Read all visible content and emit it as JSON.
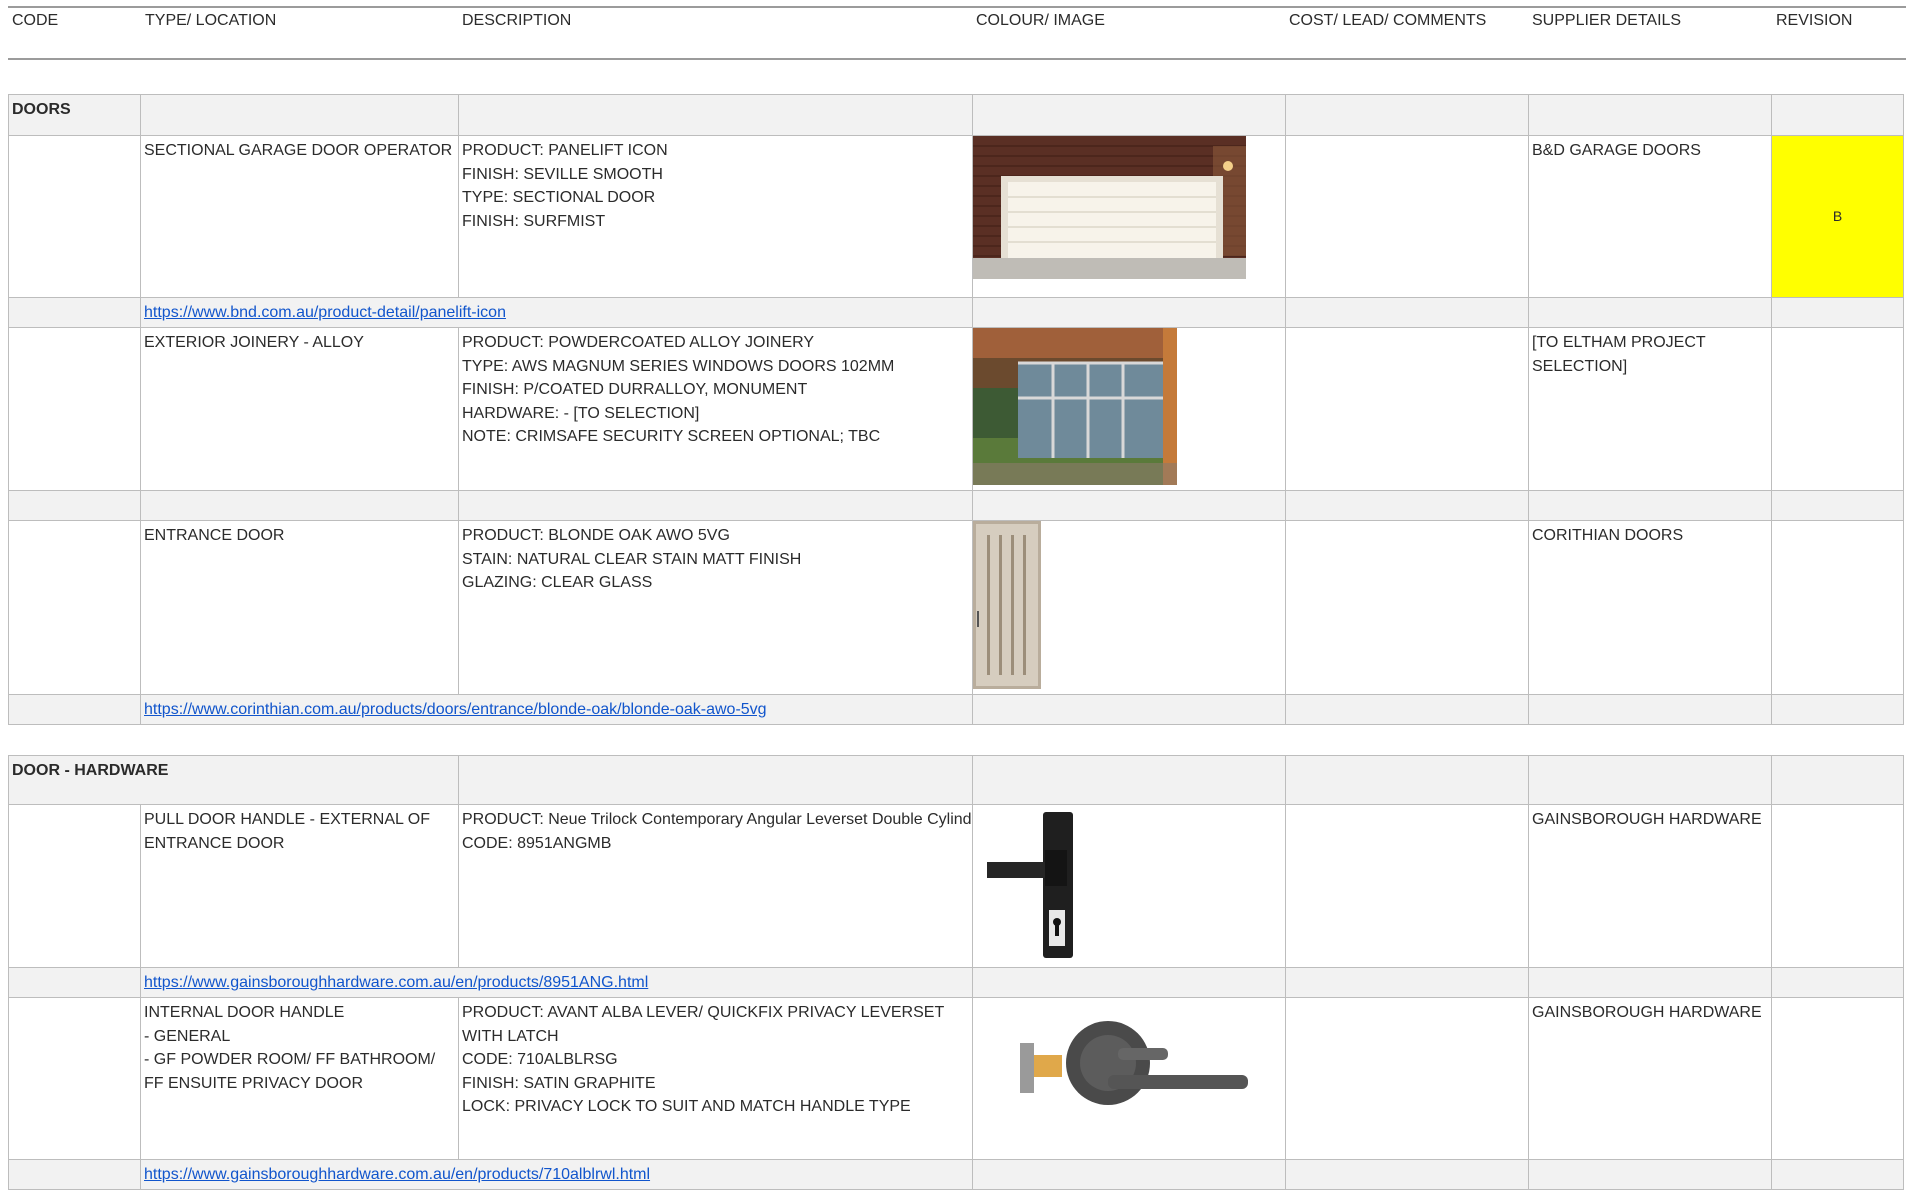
{
  "header": {
    "code": "CODE",
    "type": "TYPE/ LOCATION",
    "description": "DESCRIPTION",
    "colour": "COLOUR/ IMAGE",
    "cost": "COST/ LEAD/ COMMENTS",
    "supplier": "SUPPLIER DETAILS",
    "revision": "REVISION"
  },
  "doors": {
    "section_title": "DOORS",
    "garage": {
      "type": "SECTIONAL GARAGE DOOR OPERATOR",
      "desc": [
        "PRODUCT: PANELIFT ICON",
        "FINISH: SEVILLE SMOOTH",
        "TYPE: SECTIONAL DOOR",
        "FINISH: SURFMIST"
      ],
      "supplier": "B&D GARAGE DOORS",
      "revision": "B",
      "revision_color": "#ffff00",
      "link": "https://www.bnd.com.au/product-detail/panelift-icon"
    },
    "joinery": {
      "type": "EXTERIOR JOINERY - ALLOY",
      "desc": [
        "PRODUCT: POWDERCOATED ALLOY JOINERY",
        "TYPE: AWS MAGNUM SERIES WINDOWS DOORS 102MM",
        "FINISH: P/COATED DURRALLOY, MONUMENT",
        "HARDWARE: - [TO SELECTION]",
        "NOTE: CRIMSAFE SECURITY SCREEN OPTIONAL; TBC"
      ],
      "supplier": "[TO ELTHAM PROJECT SELECTION]"
    },
    "entrance": {
      "type": "ENTRANCE DOOR",
      "desc": [
        "PRODUCT: BLONDE OAK AWO 5VG",
        "STAIN: NATURAL CLEAR STAIN MATT FINISH",
        "GLAZING: CLEAR GLASS"
      ],
      "supplier": "CORITHIAN DOORS",
      "link": "https://www.corinthian.com.au/products/doors/entrance/blonde-oak/blonde-oak-awo-5vg"
    }
  },
  "hardware": {
    "section_title": "DOOR - HARDWARE",
    "pull": {
      "type": "PULL DOOR HANDLE - EXTERNAL OF ENTRANCE DOOR",
      "desc": [
        "PRODUCT: Neue Trilock Contemporary Angular Leverset Double Cylinder",
        "CODE: 8951ANGMB"
      ],
      "supplier": "GAINSBOROUGH HARDWARE",
      "link": "https://www.gainsboroughhardware.com.au/en/products/8951ANG.html"
    },
    "internal": {
      "type": [
        "INTERNAL DOOR HANDLE",
        "- GENERAL",
        "- GF POWDER ROOM/ FF BATHROOM/ FF ENSUITE PRIVACY DOOR"
      ],
      "desc": [
        "PRODUCT: AVANT ALBA LEVER/ QUICKFIX PRIVACY LEVERSET WITH LATCH",
        "CODE: 710ALBLRSG",
        "FINISH: SATIN GRAPHITE",
        "LOCK: PRIVACY LOCK TO SUIT AND MATCH HANDLE TYPE"
      ],
      "supplier": "GAINSBOROUGH HARDWARE",
      "link": "https://www.gainsboroughhardware.com.au/en/products/710alblrwl.html"
    }
  },
  "icons": {
    "garage_image": "garage-door-photo",
    "joinery_image": "alloy-joinery-photo",
    "entrance_image": "entrance-door-photo",
    "pull_image": "door-leverset-photo",
    "internal_image": "lever-handle-photo"
  }
}
